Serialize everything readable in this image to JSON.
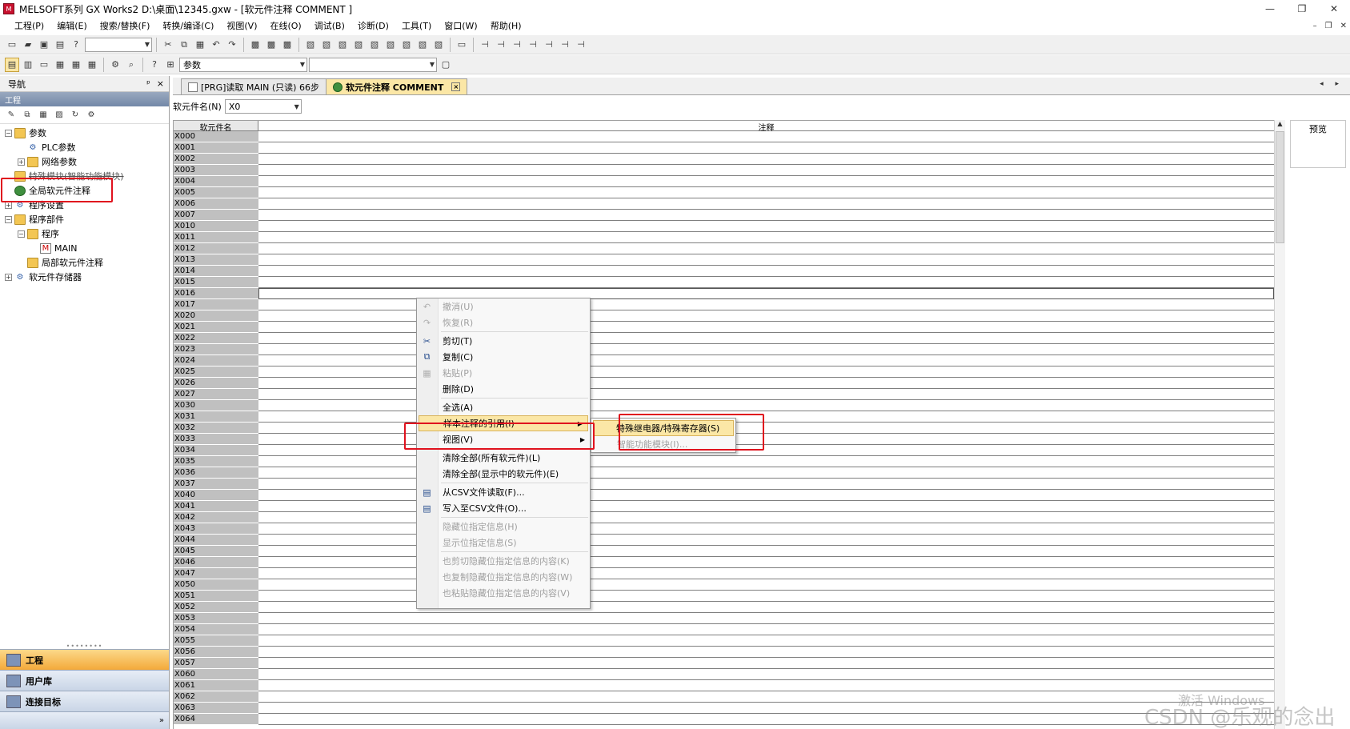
{
  "window": {
    "title": "MELSOFT系列 GX Works2 D:\\桌面\\12345.gxw - [软元件注释 COMMENT ]",
    "controls": [
      "—",
      "❐",
      "✕"
    ],
    "mdi_controls": [
      "–",
      "❐",
      "✕"
    ]
  },
  "menu": [
    "工程(P)",
    "编辑(E)",
    "搜索/替换(F)",
    "转换/编译(C)",
    "视图(V)",
    "在线(O)",
    "调试(B)",
    "诊断(D)",
    "工具(T)",
    "窗口(W)",
    "帮助(H)"
  ],
  "toolbar2": {
    "combo1_value": "参数",
    "combo2_value": ""
  },
  "nav": {
    "title": "导航",
    "pin": "ᵖ",
    "close": "×",
    "section": "工程",
    "tree": [
      {
        "label": "参数",
        "exp": "−",
        "indent": 0,
        "icon": "folder"
      },
      {
        "label": "PLC参数",
        "exp": "",
        "indent": 1,
        "icon": "gear"
      },
      {
        "label": "网络参数",
        "exp": "+",
        "indent": 1,
        "icon": "folder"
      },
      {
        "label": "特殊模块(智能功能模块)",
        "exp": "",
        "indent": 0,
        "icon": "folder",
        "strike": true
      },
      {
        "label": "全局软元件注释",
        "exp": "",
        "indent": 0,
        "icon": "globe"
      },
      {
        "label": "程序设置",
        "exp": "+",
        "indent": 0,
        "icon": "gear"
      },
      {
        "label": "程序部件",
        "exp": "−",
        "indent": 0,
        "icon": "folder"
      },
      {
        "label": "程序",
        "exp": "−",
        "indent": 1,
        "icon": "folder"
      },
      {
        "label": "MAIN",
        "exp": "",
        "indent": 2,
        "icon": "doc"
      },
      {
        "label": "局部软元件注释",
        "exp": "",
        "indent": 1,
        "icon": "folder"
      },
      {
        "label": "软元件存储器",
        "exp": "+",
        "indent": 0,
        "icon": "gear"
      }
    ],
    "bottom_buttons": [
      "工程",
      "用户库",
      "连接目标"
    ],
    "footer": "»"
  },
  "tabs": [
    {
      "label": "[PRG]读取 MAIN (只读) 66步",
      "active": false
    },
    {
      "label": "软元件注释 COMMENT",
      "active": true
    }
  ],
  "tab_close": "×",
  "tab_nav": "◂ ▸",
  "editor": {
    "device_label": "软元件名(N)",
    "device_value": "X0",
    "col_device": "软元件名",
    "col_comment": "注释",
    "preview_label": "预览",
    "rows": [
      "X000",
      "X001",
      "X002",
      "X003",
      "X004",
      "X005",
      "X006",
      "X007",
      "X010",
      "X011",
      "X012",
      "X013",
      "X014",
      "X015",
      "X016",
      "X017",
      "X020",
      "X021",
      "X022",
      "X023",
      "X024",
      "X025",
      "X026",
      "X027",
      "X030",
      "X031",
      "X032",
      "X033",
      "X034",
      "X035",
      "X036",
      "X037",
      "X040",
      "X041",
      "X042",
      "X043",
      "X044",
      "X045",
      "X046",
      "X047",
      "X050",
      "X051",
      "X052",
      "X053",
      "X054",
      "X055",
      "X056",
      "X057",
      "X060",
      "X061",
      "X062",
      "X063",
      "X064"
    ]
  },
  "context_menu": [
    {
      "label": "撤消(U)",
      "disabled": true,
      "icon": "undo-icon"
    },
    {
      "label": "恢复(R)",
      "disabled": true,
      "icon": "redo-icon"
    },
    {
      "sep": true
    },
    {
      "label": "剪切(T)",
      "disabled": false,
      "icon": "scissors-icon"
    },
    {
      "label": "复制(C)",
      "disabled": false,
      "icon": "copy-icon"
    },
    {
      "label": "粘贴(P)",
      "disabled": true,
      "icon": "paste-icon"
    },
    {
      "label": "删除(D)",
      "disabled": false
    },
    {
      "sep": true
    },
    {
      "label": "全选(A)",
      "disabled": false
    },
    {
      "label": "样本注释的引用(I)",
      "disabled": false,
      "highlight": true,
      "submenu": true
    },
    {
      "label": "视图(V)",
      "disabled": false,
      "submenu": true
    },
    {
      "sep": true
    },
    {
      "label": "清除全部(所有软元件)(L)",
      "disabled": false
    },
    {
      "label": "清除全部(显示中的软元件)(E)",
      "disabled": false
    },
    {
      "sep": true
    },
    {
      "label": "从CSV文件读取(F)...",
      "disabled": false,
      "icon": "csv-read-icon"
    },
    {
      "label": "写入至CSV文件(O)...",
      "disabled": false,
      "icon": "csv-write-icon"
    },
    {
      "sep": true
    },
    {
      "label": "隐藏位指定信息(H)",
      "disabled": true
    },
    {
      "label": "显示位指定信息(S)",
      "disabled": true
    },
    {
      "sep": true
    },
    {
      "label": "也剪切隐藏位指定信息的内容(K)",
      "disabled": true
    },
    {
      "label": "也复制隐藏位指定信息的内容(W)",
      "disabled": true
    },
    {
      "label": "也粘贴隐藏位指定信息的内容(V)",
      "disabled": true
    }
  ],
  "submenu": [
    {
      "label": "特殊继电器/特殊寄存器(S)",
      "highlight": true,
      "disabled": false
    },
    {
      "label": "智能功能模块(I)...",
      "highlight": false,
      "disabled": true
    }
  ],
  "watermarks": {
    "windows": "激活 Windows",
    "csdn": "CSDN @乐观的念出"
  },
  "colors": {
    "highlight": "#fbe7a6",
    "annotation_box": "#e0121e",
    "device_cell": "#c0c0c0"
  }
}
